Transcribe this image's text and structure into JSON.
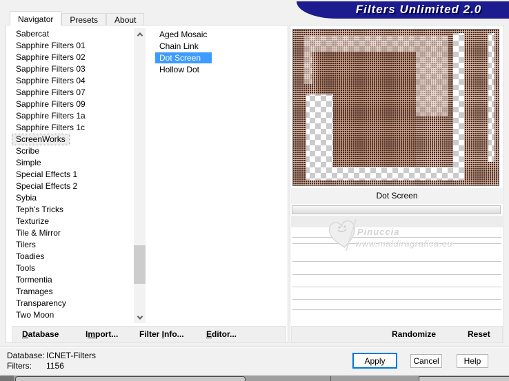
{
  "title_banner": "Filters Unlimited 2.0",
  "tabs": [
    {
      "label": "Navigator",
      "selected": true
    },
    {
      "label": "Presets"
    },
    {
      "label": "About"
    }
  ],
  "category_list": {
    "items": [
      "Sabercat",
      "Sapphire Filters 01",
      "Sapphire Filters 02",
      "Sapphire Filters 03",
      "Sapphire Filters 04",
      "Sapphire Filters 07",
      "Sapphire Filters 09",
      "Sapphire Filters 1a",
      "Sapphire Filters 1c",
      {
        "label": "ScreenWorks",
        "selected": true
      },
      "Scribe",
      "Simple",
      "Special Effects 1",
      "Special Effects 2",
      "Sybia",
      "Teph's Tricks",
      "Texturize",
      "Tile & Mirror",
      "Tilers",
      "Toadies",
      "Tools",
      "Tormentia",
      "Tramages",
      "Transparency",
      "Two Moon"
    ]
  },
  "filter_list": {
    "items": [
      "Aged Mosaic",
      "Chain Link",
      {
        "label": "Dot Screen",
        "selected": true
      },
      "Hollow Dot"
    ]
  },
  "preview": {
    "caption": "Dot Screen"
  },
  "watermark": {
    "name": "Pinuccia",
    "url": "www.maldiragrafica.eu"
  },
  "toolbar": {
    "database": {
      "pre": "",
      "key": "D",
      "post": "atabase"
    },
    "import": {
      "pre": "I",
      "key": "m",
      "post": "port..."
    },
    "filter_info": {
      "pre": "Filter ",
      "key": "I",
      "post": "nfo..."
    },
    "editor": {
      "pre": "",
      "key": "E",
      "post": "ditor..."
    }
  },
  "actions": {
    "randomize": "Randomize",
    "reset": "Reset"
  },
  "status": {
    "database_label": "Database:",
    "database_value": "ICNET-Filters",
    "filters_label": "Filters:",
    "filters_value": "1156"
  },
  "buttons": {
    "apply": "Apply",
    "cancel": "Cancel",
    "help": "Help"
  },
  "colors": {
    "banner": "#1c1c8f",
    "selection": "#3e9bff",
    "apply_focus_border": "#0078d7",
    "preview_base": "#dfbcaa",
    "preview_dark": "#c99e88",
    "checker_gray": "#cbcbcb"
  }
}
